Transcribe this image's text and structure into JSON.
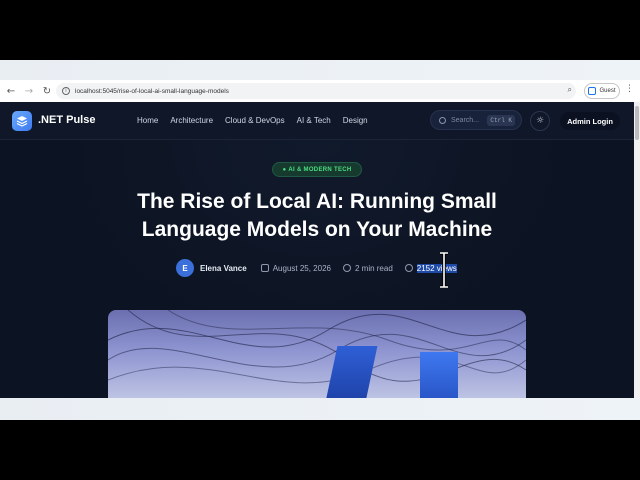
{
  "browser": {
    "url": "localhost:5045/rise-of-local-ai-small-language-models",
    "profile_label": "Guest",
    "icons": [
      "back-icon",
      "forward-icon",
      "reload-icon",
      "info-icon",
      "zoom-icon",
      "kebab-menu-icon"
    ]
  },
  "site": {
    "brand": ".NET Pulse",
    "nav": [
      "Home",
      "Architecture",
      "Cloud & DevOps",
      "AI & Tech",
      "Design"
    ],
    "search_placeholder": "Search...",
    "search_shortcut": "Ctrl K",
    "admin_label": "Admin Login",
    "accent_color": "#3d7bf0"
  },
  "article": {
    "category": "AI & MODERN TECH",
    "title_line1": "The Rise of Local AI: Running Small",
    "title_line2": "Language Models on Your Machine",
    "author_initial": "E",
    "author": "Elena Vance",
    "date": "August 25, 2026",
    "read_time": "2 min read",
    "views_selected": "2152 vi",
    "views_rest": "ews",
    "views_full": "2152 views"
  }
}
